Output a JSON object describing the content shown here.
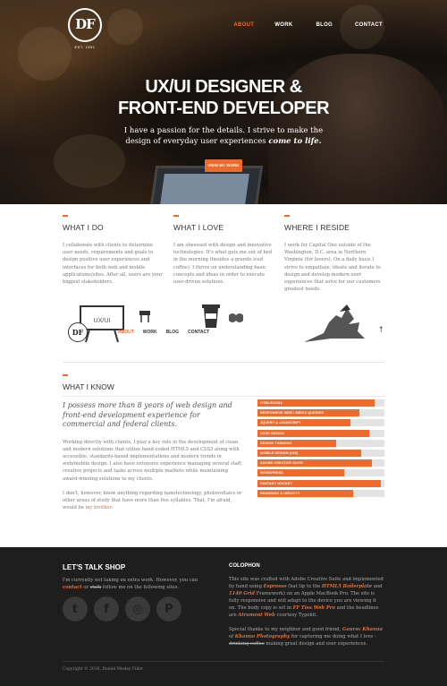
{
  "nav": {
    "items": [
      "ABOUT",
      "WORK",
      "BLOG",
      "CONTACT"
    ],
    "active": "ABOUT"
  },
  "logo": {
    "monogram": "DF",
    "est": "EST. 1991"
  },
  "hero": {
    "title_line1": "UX/UI DESIGNER &",
    "title_line2": "FRONT-END DEVELOPER",
    "subtitle_a": "I have a passion for the details. I strive to make the design of everyday user experiences ",
    "subtitle_b": "come to life.",
    "button": "VIEW MY WORK"
  },
  "columns": [
    {
      "title": "WHAT I DO",
      "text": "I collaborate with clients to determine user needs, requirements and goals to design positive user experiences and interfaces for both web and mobile applications/sites. After all, users are your biggest stakeholders."
    },
    {
      "title": "WHAT I LOVE",
      "text": "I am obsessed with design and innovative technologies. It's what gets me out of bed in the morning (besides a grande iced coffee). I thrive on understanding basic concepts and ideas in order to execute user-driven solutions."
    },
    {
      "title": "WHERE I RESIDE",
      "text": "I work for Capital One outside of the Washington, D.C. area in Northern Virginia (for lovers). On a daily basis I strive to empathize, ideate and iterate to design and develop modern user experiences that solve for our customers greatest needs."
    }
  ],
  "illustration": {
    "sign_text": "UX/UI"
  },
  "sticky": {
    "monogram": "DF",
    "items": [
      "ABOUT",
      "WORK",
      "BLOG",
      "CONTACT"
    ],
    "up_icon": "arrow-up-icon"
  },
  "know": {
    "title": "WHAT I KNOW",
    "lead": "I possess more than 8 years of web design and front-end development experience for commercial and federal clients.",
    "p1": "Working directly with clients, I play a key role in the development of clean and modern solutions that utilize hand-coded HTML5 and CSS3 along with accessible, standards-based implementations and modern trends in web/mobile design. I also have extensive experience managing several staff, creative projects and tasks across multiple markets while maintaining award-winning solutions to my clients.",
    "p2a": "I don't, however, know anything regarding nanotechnology, photovoltaics or other areas of study that have more than five syllables. That, I'm afraid, would be ",
    "p2_link": "my brother",
    "p2b": "."
  },
  "skills": [
    {
      "label": "HTML5/CSS3",
      "value": 0.92
    },
    {
      "label": "RESPONSIVE WEB / MEDIA QUERIES",
      "value": 0.8
    },
    {
      "label": "JQUERY & JAVASCRIPT",
      "value": 0.73
    },
    {
      "label": "UX/UI DESIGN",
      "value": 0.88
    },
    {
      "label": "DESIGN THINKING",
      "value": 0.62
    },
    {
      "label": "MOBILE DESIGN (IOS)",
      "value": 0.82
    },
    {
      "label": "ADOBE CREATIVE SUITE",
      "value": 0.9
    },
    {
      "label": "WORDPRESS",
      "value": 0.68
    },
    {
      "label": "FANTASY HOCKEY",
      "value": 0.97
    },
    {
      "label": "BRANDING & IDENTITY",
      "value": 0.75
    }
  ],
  "footer": {
    "shop_title": "LET'S TALK SHOP",
    "shop_a": "I'm currently not taking on extra work. However, you can ",
    "shop_link": "contact",
    "shop_b": " or ",
    "shop_stalk": "stalk",
    "shop_c": " follow me on the following sites.",
    "socials": [
      "twitter-icon",
      "facebook-icon",
      "dribbble-icon",
      "pinterest-icon"
    ],
    "colophon_title": "COLOPHON",
    "col_p1_a": "This site was crafted with Adobe Creative Suite and implemented by hand using ",
    "col_p1_b": "Espresso",
    "col_p1_c": " (hat tip to the ",
    "col_p1_d": "HTML5 Boilerplate",
    "col_p1_e": " and ",
    "col_p1_f": "1140 Grid",
    "col_p1_g": " Framework) on an Apple MacBook Pro. The site is fully responsive and will adapt to the device you are viewing it on. The body copy is set in ",
    "col_p1_h": "FF Tisa Web Pro",
    "col_p1_i": " and the headlines are ",
    "col_p1_j": "Atrament Web",
    "col_p1_k": " courtesy Typekit.",
    "col_p2_a": "Special thanks to my neighbor and good friend, ",
    "col_p2_b": "Gaurav Khanna",
    "col_p2_c": " of ",
    "col_p2_d": "Khanna Photography",
    "col_p2_e": " for capturing me doing what I love - ",
    "col_p2_f": "drinking coffee",
    "col_p2_g": " making great design and user experiences.",
    "copyright": "Copyright © 2016, Daniel Wesley Filler"
  },
  "colors": {
    "accent": "#f06a2b",
    "footer_bg": "#1e1e1e"
  }
}
